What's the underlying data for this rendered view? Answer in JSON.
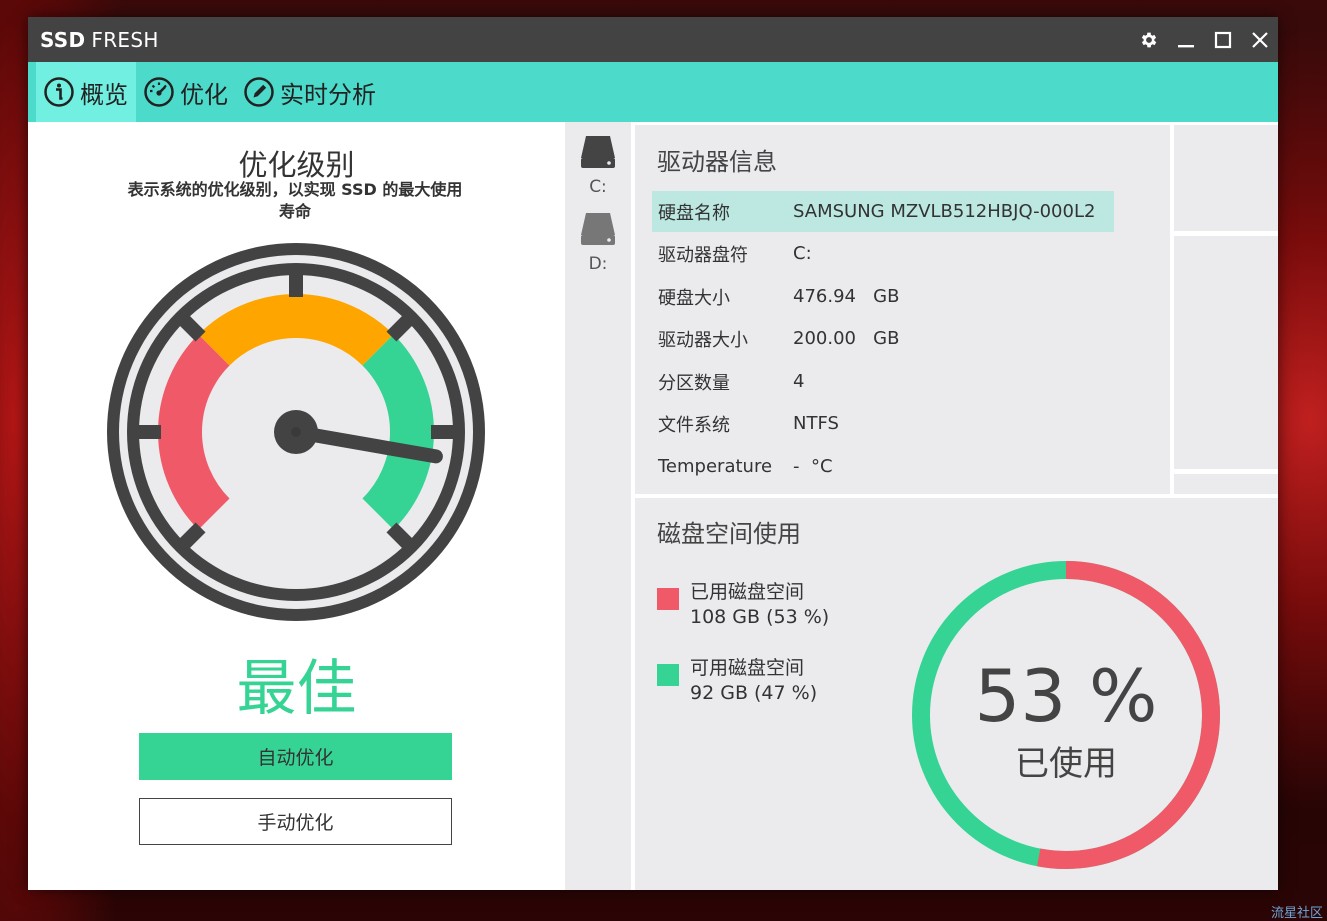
{
  "app": {
    "title_bold": "SSD",
    "title_rest": "FRESH"
  },
  "window_controls": {
    "settings_icon": "gear-icon",
    "minimize_icon": "minimize-icon",
    "maximize_icon": "maximize-icon",
    "close_icon": "close-icon"
  },
  "nav": {
    "tabs": [
      {
        "label": "概览",
        "icon": "info-icon",
        "active": true
      },
      {
        "label": "优化",
        "icon": "speedometer-icon",
        "active": false
      },
      {
        "label": "实时分析",
        "icon": "pencil-icon",
        "active": false
      }
    ]
  },
  "optimization": {
    "title": "优化级别",
    "subtitle": "表示系统的优化级别，以实现 SSD 的最大使用寿命",
    "grade": "最佳",
    "auto_button": "自动优化",
    "manual_button": "手动优化",
    "gauge_level": 0.87,
    "colors": {
      "bad": "#f05a68",
      "mid": "#ffa500",
      "good": "#36d494",
      "dark": "#434343"
    }
  },
  "drives": [
    {
      "label": "C:",
      "selected": true
    },
    {
      "label": "D:",
      "selected": false
    }
  ],
  "drive_info": {
    "title": "驱动器信息",
    "rows": [
      {
        "key": "硬盘名称",
        "value": "SAMSUNG MZVLB512HBJQ-000L2"
      },
      {
        "key": "驱动器盘符",
        "value": "C:"
      },
      {
        "key": "硬盘大小",
        "value": "476.94   GB"
      },
      {
        "key": "驱动器大小",
        "value": "200.00   GB"
      },
      {
        "key": "分区数量",
        "value": "4"
      },
      {
        "key": "文件系统",
        "value": "NTFS"
      },
      {
        "key": "Temperature",
        "value": "-  °C"
      }
    ]
  },
  "disk_usage": {
    "title": "磁盘空间使用",
    "used_label": "已用磁盘空间",
    "used_value": "108 GB (53 %)",
    "free_label": "可用磁盘空间",
    "free_value": "92 GB (47 %)",
    "percent": "53 %",
    "percent_label": "已使用",
    "used_fraction": 0.53,
    "colors": {
      "used": "#f05a68",
      "free": "#36d494"
    }
  },
  "watermark": "流星社区"
}
